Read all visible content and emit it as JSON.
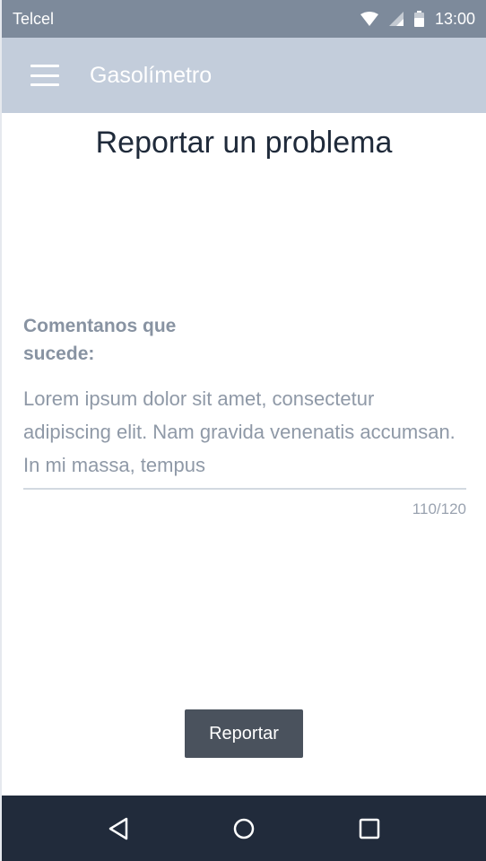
{
  "status_bar": {
    "carrier": "Telcel",
    "time": "13:00",
    "icons": [
      "wifi-icon",
      "signal-icon",
      "battery-icon"
    ]
  },
  "app_bar": {
    "title": "Gasolímetro",
    "menu_icon": "hamburger-menu-icon"
  },
  "page": {
    "title": "Reportar un problema",
    "field_label": "Comentanos que sucede:",
    "comment_value": "Lorem ipsum dolor sit amet, consectetur adipiscing elit. Nam gravida venenatis accumsan. In mi massa, tempus",
    "char_counter": "110/120",
    "submit_label": "Reportar"
  },
  "nav_bar": {
    "buttons": [
      "back-icon",
      "home-icon",
      "recents-icon"
    ]
  },
  "colors": {
    "status_bar": "#7d8a9b",
    "app_bar": "#c3cddb",
    "title_text": "#1f2a3a",
    "button": "#4a525d",
    "nav_bar": "#212b3b"
  }
}
